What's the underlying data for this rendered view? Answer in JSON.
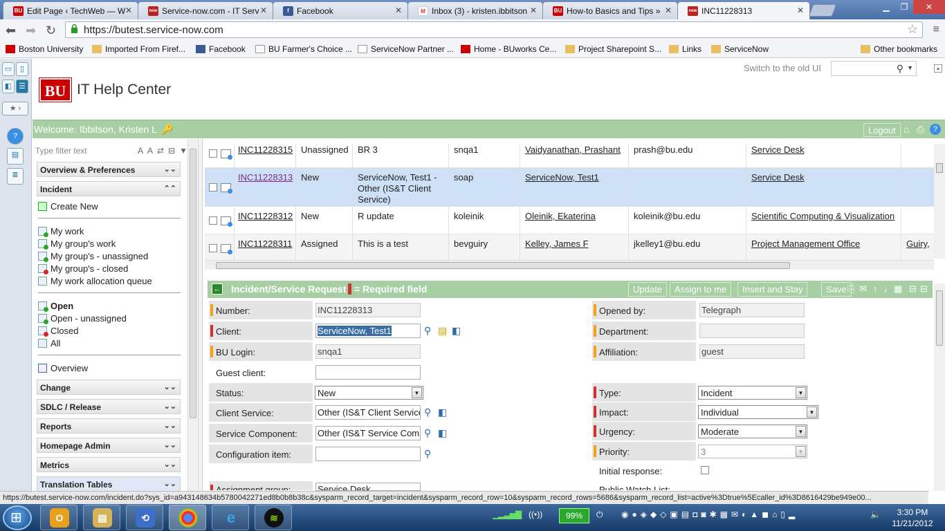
{
  "browser": {
    "tabs": [
      {
        "title": "Edit Page ‹ TechWeb — W",
        "favicon": "BU",
        "color": "#cc0000"
      },
      {
        "title": "Service-now.com - IT Serv",
        "favicon": "now",
        "color": "#b22"
      },
      {
        "title": "Facebook",
        "favicon": "f",
        "color": "#3b5998"
      },
      {
        "title": "Inbox (3) - kristen.ibbitson",
        "favicon": "M",
        "color": "#d33"
      },
      {
        "title": "How-to Basics and Tips »",
        "favicon": "BU",
        "color": "#cc0000"
      },
      {
        "title": "INC11228313",
        "favicon": "now",
        "color": "#b22"
      }
    ],
    "url": "https://butest.service-now.com",
    "bookmarks": [
      {
        "label": "Boston University",
        "icon": "bu-icon"
      },
      {
        "label": "Imported From Firef...",
        "icon": "folder-icon"
      },
      {
        "label": "Facebook",
        "icon": "facebook-icon"
      },
      {
        "label": "BU Farmer's Choice ...",
        "icon": "page-icon"
      },
      {
        "label": "ServiceNow Partner ...",
        "icon": "page-icon"
      },
      {
        "label": "Home - BUworks Ce...",
        "icon": "bu-icon"
      },
      {
        "label": "Project Sharepoint S...",
        "icon": "folder-icon"
      },
      {
        "label": "Links",
        "icon": "folder-icon"
      },
      {
        "label": "ServiceNow",
        "icon": "folder-icon"
      },
      {
        "label": "Other bookmarks",
        "icon": "folder-icon"
      }
    ]
  },
  "header": {
    "logo": "BU",
    "title": "IT Help Center",
    "switch_ui": "Switch to the old UI"
  },
  "welcome": {
    "text": "Welcome: Ibbitson, Kristen L",
    "logout": "Logout"
  },
  "navigator": {
    "filter_placeholder": "Type filter text",
    "sections": {
      "overview": "Overview & Preferences",
      "incident": "Incident",
      "change": "Change",
      "sdlc": "SDLC / Release",
      "reports": "Reports",
      "homepage_admin": "Homepage Admin",
      "metrics": "Metrics",
      "translation": "Translation Tables"
    },
    "create_new": "Create New",
    "group1": [
      "My work",
      "My group's work",
      "My group's - unassigned",
      "My group's - closed",
      "My work allocation queue"
    ],
    "group2": [
      "Open",
      "Open - unassigned",
      "Closed",
      "All"
    ],
    "overview_link": "Overview"
  },
  "list_rows": [
    {
      "number": "INC11228315",
      "state": "Unassigned",
      "short_desc": "BR 3",
      "login": "snqa1",
      "client": "Vaidyanathan, Prashant",
      "email": "prash@bu.edu",
      "group": "Service Desk",
      "assigned": ""
    },
    {
      "number": "INC11228313",
      "state": "New",
      "short_desc": "ServiceNow, Test1 - Other (IS&T Client Service)",
      "login": "soap",
      "client": "ServiceNow, Test1",
      "email": "",
      "group": "Service Desk",
      "assigned": ""
    },
    {
      "number": "INC11228312",
      "state": "New",
      "short_desc": "R update",
      "login": "koleinik",
      "client": "Oleinik, Ekaterina",
      "email": "koleinik@bu.edu",
      "group": "Scientific Computing & Visualization",
      "assigned": ""
    },
    {
      "number": "INC11228311",
      "state": "Assigned",
      "short_desc": "This is a test",
      "login": "bevguiry",
      "client": "Kelley, James F",
      "email": "jkelley1@bu.edu",
      "group": "Project Management Office",
      "assigned": "Guiry,"
    }
  ],
  "form": {
    "title": "Incident/Service Request",
    "required_note": "= Required field",
    "buttons": {
      "update": "Update",
      "assign": "Assign to me",
      "insert_stay": "Insert and Stay",
      "save": "Save"
    },
    "labels": {
      "number": "Number:",
      "client": "Client:",
      "bu_login": "BU Login:",
      "guest_client": "Guest client:",
      "status": "Status:",
      "client_service": "Client Service:",
      "service_component": "Service Component:",
      "config_item": "Configuration item:",
      "assignment_group": "Assignment group:",
      "opened_by": "Opened by:",
      "department": "Department:",
      "affiliation": "Affiliation:",
      "type": "Type:",
      "impact": "Impact:",
      "urgency": "Urgency:",
      "priority": "Priority:",
      "initial_response": "Initial response:",
      "watch_list": "Public Watch List:"
    },
    "values": {
      "number": "INC11228313",
      "client": "ServiceNow, Test1",
      "bu_login": "snqa1",
      "guest_client": "",
      "status": "New",
      "client_service": "Other (IS&T Client Service)",
      "service_component": "Other (IS&T Service Component)",
      "config_item": "",
      "assignment_group": "Service Desk",
      "opened_by": "Telegraph",
      "department": "",
      "affiliation": "guest",
      "type": "Incident",
      "impact": "Individual",
      "urgency": "Moderate",
      "priority": "3",
      "initial_response": false
    }
  },
  "status_url": "https://butest.service-now.com/incident.do?sys_id=a943148634b5780042271ed8b0b8b38c&sysparm_record_target=incident&sysparm_record_row=10&sysparm_record_rows=5686&sysparm_record_list=active%3Dtrue%5Ecaller_id%3D8616429be949e00...",
  "taskbar": {
    "battery": "99%",
    "time": "3:30 PM",
    "date": "11/21/2012"
  }
}
